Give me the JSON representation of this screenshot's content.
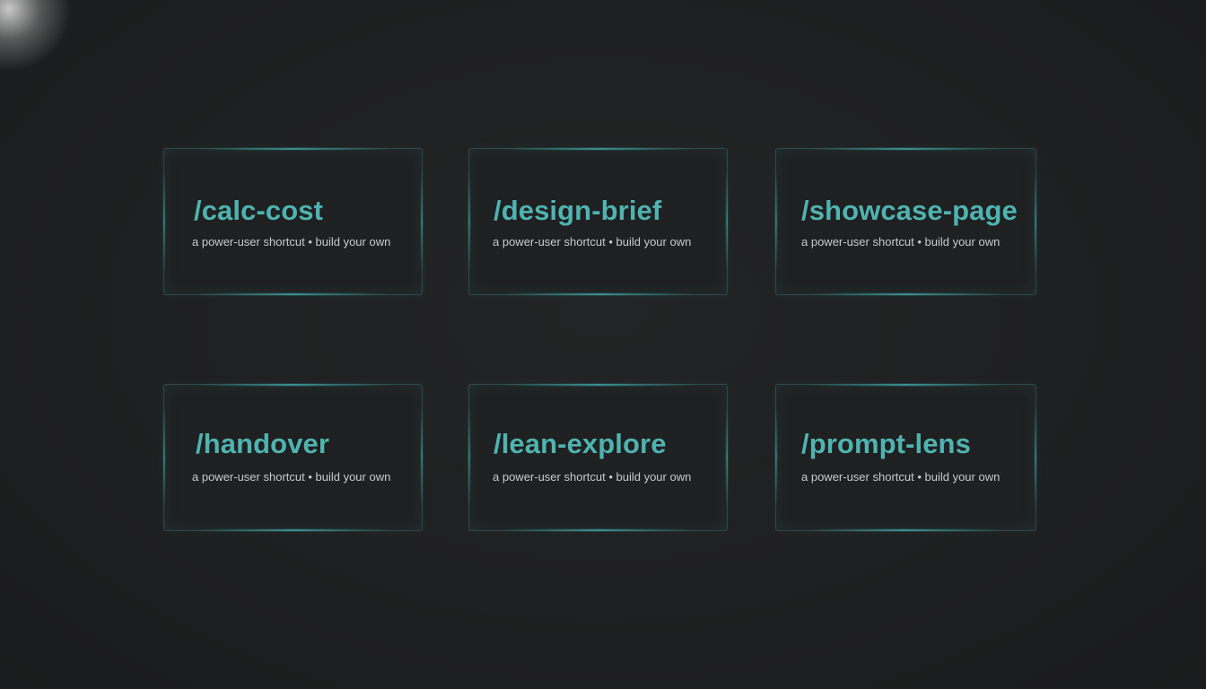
{
  "cards": [
    {
      "command": "/calc-cost",
      "subtitle": "a power-user shortcut • build your own"
    },
    {
      "command": "/design-brief",
      "subtitle": "a power-user shortcut • build your own"
    },
    {
      "command": "/showcase-page",
      "subtitle": "a power-user shortcut • build your own"
    },
    {
      "command": "/handover",
      "subtitle": "a power-user shortcut • build your own"
    },
    {
      "command": "/lean-explore",
      "subtitle": "a power-user shortcut • build your own"
    },
    {
      "command": "/prompt-lens",
      "subtitle": "a power-user shortcut • build your own"
    }
  ],
  "colors": {
    "background": "#1e1f20",
    "accent": "#4fb3b0",
    "subtitle": "#c9cacb"
  }
}
